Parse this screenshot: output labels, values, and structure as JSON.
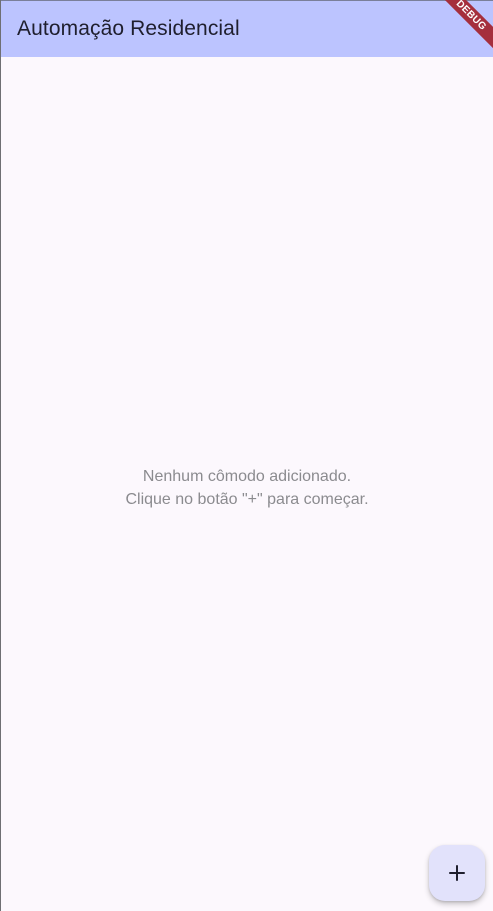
{
  "app_bar": {
    "title": "Automação Residencial",
    "background_color": "#bcc4ff"
  },
  "debug_banner": {
    "label": "DEBUG",
    "color": "#a52f3d"
  },
  "empty_state": {
    "line1": "Nenhum cômodo adicionado.",
    "line2": "Clique no botão \"+\" para começar.",
    "text_color": "#8b8b8f"
  },
  "fab": {
    "icon": "plus-icon",
    "background_color": "#e2e2fb"
  },
  "colors": {
    "page_background": "#fcf8fd"
  }
}
